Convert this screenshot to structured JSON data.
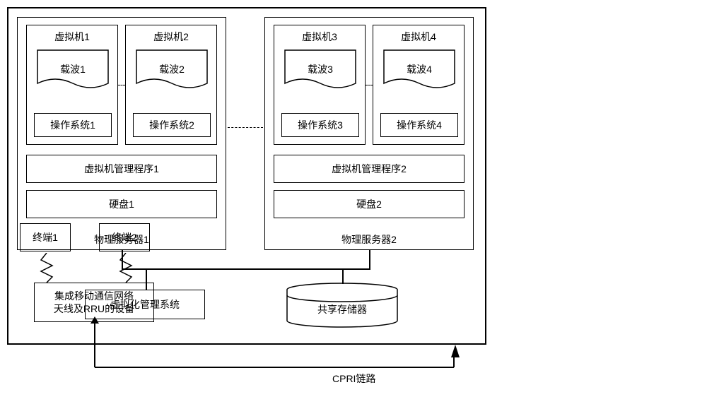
{
  "terminals": {
    "t1": "终端1",
    "t2": "终端2"
  },
  "rru": "集成移动通信网络\n天线及RRU的设备",
  "cpri": "CPRI链路",
  "outer": {
    "ps1": {
      "label": "物理服务器1",
      "vm1": {
        "title": "虚拟机1",
        "carrier": "载波1",
        "os": "操作系统1"
      },
      "vm2": {
        "title": "虚拟机2",
        "carrier": "载波2",
        "os": "操作系统2"
      },
      "hyper": "虚拟机管理程序1",
      "disk": "硬盘1"
    },
    "ps2": {
      "label": "物理服务器2",
      "vm3": {
        "title": "虚拟机3",
        "carrier": "载波3",
        "os": "操作系统3"
      },
      "vm4": {
        "title": "虚拟机4",
        "carrier": "载波4",
        "os": "操作系统4"
      },
      "hyper": "虚拟机管理程序2",
      "disk": "硬盘2"
    },
    "vmgr": "虚拟化管理系统",
    "storage": "共享存储器"
  }
}
